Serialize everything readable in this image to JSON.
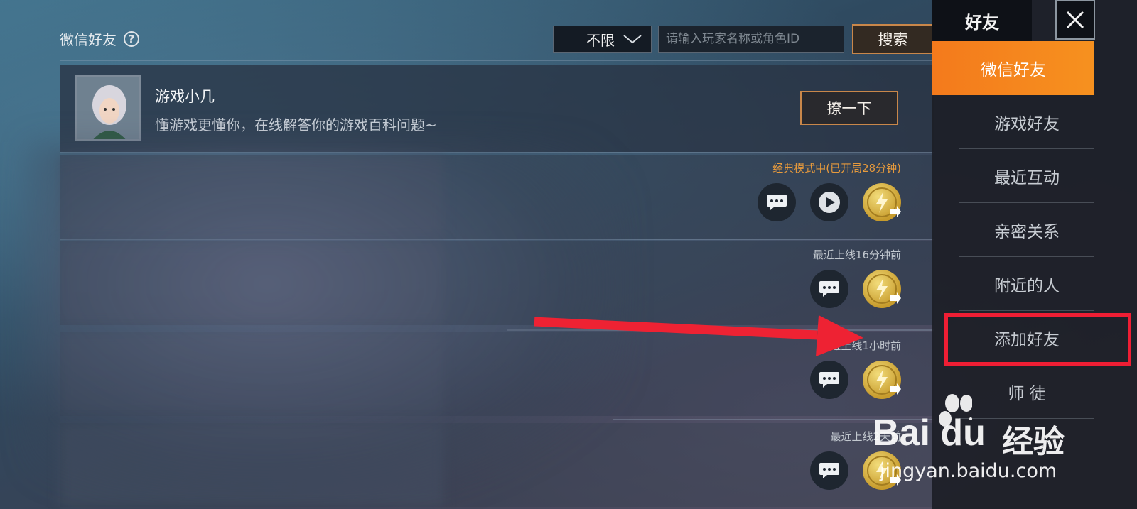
{
  "header": {
    "title": "微信好友",
    "filter_value": "不限",
    "search_placeholder": "请输入玩家名称或角色ID",
    "search_label": "搜索"
  },
  "bot": {
    "name": "游戏小几",
    "desc": "懂游戏更懂你，在线解答你的游戏百科问题~",
    "action_label": "撩一下"
  },
  "friends": [
    {
      "status": "经典模式中(已开局28分钟)",
      "icons": [
        "chat-icon",
        "play-icon",
        "bolt-gift-icon"
      ]
    },
    {
      "status": "最近上线16分钟前",
      "icons": [
        "chat-icon",
        "bolt-gift-icon"
      ]
    },
    {
      "status": "最近上线1小时前",
      "icons": [
        "chat-icon",
        "bolt-gift-icon"
      ]
    },
    {
      "status": "最近上线2天前",
      "icons": [
        "chat-icon",
        "bolt-gift-icon"
      ]
    }
  ],
  "sidebar": {
    "title": "好友",
    "items": [
      {
        "label": "微信好友",
        "active": true
      },
      {
        "label": "游戏好友"
      },
      {
        "label": "最近互动"
      },
      {
        "label": "亲密关系"
      },
      {
        "label": "附近的人"
      },
      {
        "label": "添加好友",
        "highlighted": true
      },
      {
        "label": "师 徒"
      }
    ]
  },
  "watermark": {
    "brand": "Bai du",
    "cn": "经验",
    "url": "jingyan.baidu.com"
  },
  "colors": {
    "accent": "#f47a1c",
    "playing_status": "#e79a3c",
    "highlight_box": "#ef1e34",
    "button_border": "#c9874a"
  }
}
